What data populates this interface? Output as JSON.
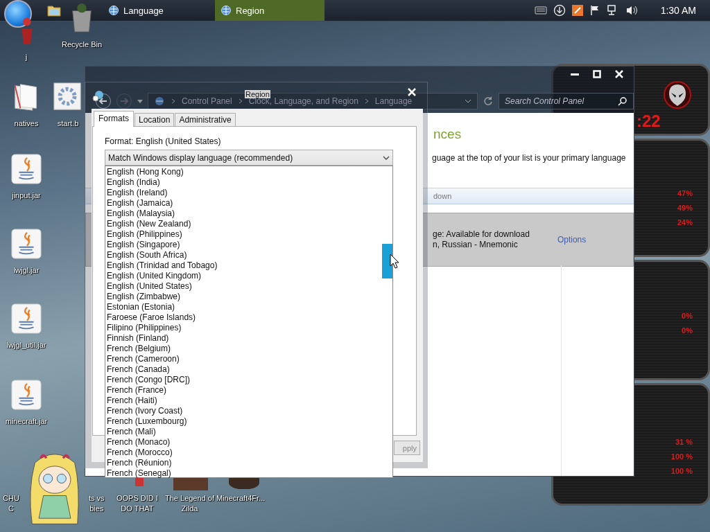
{
  "taskbar": {
    "tasks": [
      {
        "label": "Language",
        "selected": false
      },
      {
        "label": "Region",
        "selected": true
      }
    ],
    "clock": "1:30 AM"
  },
  "desktop_icons": [
    {
      "label": "j",
      "kind": "user"
    },
    {
      "label": "Recycle Bin",
      "kind": "bin"
    },
    {
      "label": "natives",
      "kind": "folder"
    },
    {
      "label": "start.b",
      "kind": "settings"
    },
    {
      "label": "jinput.jar",
      "kind": "java"
    },
    {
      "label": "lwjgl.jar",
      "kind": "java"
    },
    {
      "label": "lwjgl_util.jar",
      "kind": "java"
    },
    {
      "label": "minecraft.jar",
      "kind": "java"
    }
  ],
  "bottom_shortcuts": [
    {
      "lines": [
        "CHU",
        "C"
      ]
    },
    {
      "lines": [
        "ts vs",
        "bies"
      ]
    },
    {
      "lines": [
        "OOPS DID I",
        "DO THAT"
      ]
    },
    {
      "lines": [
        "The Legend of",
        "Zilda"
      ]
    },
    {
      "lines": [
        "Minecraft4Fr..."
      ]
    }
  ],
  "gadget": {
    "clock": ":22",
    "sections": [
      {
        "values": [
          "47%",
          "49%",
          "24%"
        ]
      },
      {
        "values": [
          "0%",
          "0%"
        ]
      },
      {
        "values": [
          "31 %",
          "100 %",
          "100 %"
        ]
      }
    ]
  },
  "control_panel": {
    "breadcrumb": [
      "Control Panel",
      "Clock, Language, and Region",
      "Language"
    ],
    "search_placeholder": "Search Control Panel",
    "heading": "nces",
    "description": "guage at the top of your list is your primary language",
    "toolbar_item": "down",
    "language_lines": [
      "ge: Available for download",
      "n, Russian - Mnemonic"
    ],
    "options_link": "Options"
  },
  "region_dialog": {
    "title": "Region",
    "tabs": [
      {
        "label": "Formats",
        "selected": true
      },
      {
        "label": "Location",
        "selected": false
      },
      {
        "label": "Administrative",
        "selected": false
      }
    ],
    "format_label": "Format: English (United States)",
    "format_value": "Match Windows display language (recommended)",
    "options": [
      "English (Hong Kong)",
      "English (India)",
      "English (Ireland)",
      "English (Jamaica)",
      "English (Malaysia)",
      "English (New Zealand)",
      "English (Philippines)",
      "English (Singapore)",
      "English (South Africa)",
      "English (Trinidad and Tobago)",
      "English (United Kingdom)",
      "English (United States)",
      "English (Zimbabwe)",
      "Estonian (Estonia)",
      "Faroese (Faroe Islands)",
      "Filipino (Philippines)",
      "Finnish (Finland)",
      "French (Belgium)",
      "French (Cameroon)",
      "French (Canada)",
      "French (Congo [DRC])",
      "French (France)",
      "French (Haiti)",
      "French (Ivory Coast)",
      "French (Luxembourg)",
      "French (Mali)",
      "French (Monaco)",
      "French (Morocco)",
      "French (Réunion)",
      "French (Senegal)"
    ],
    "apply_button": "pply"
  }
}
